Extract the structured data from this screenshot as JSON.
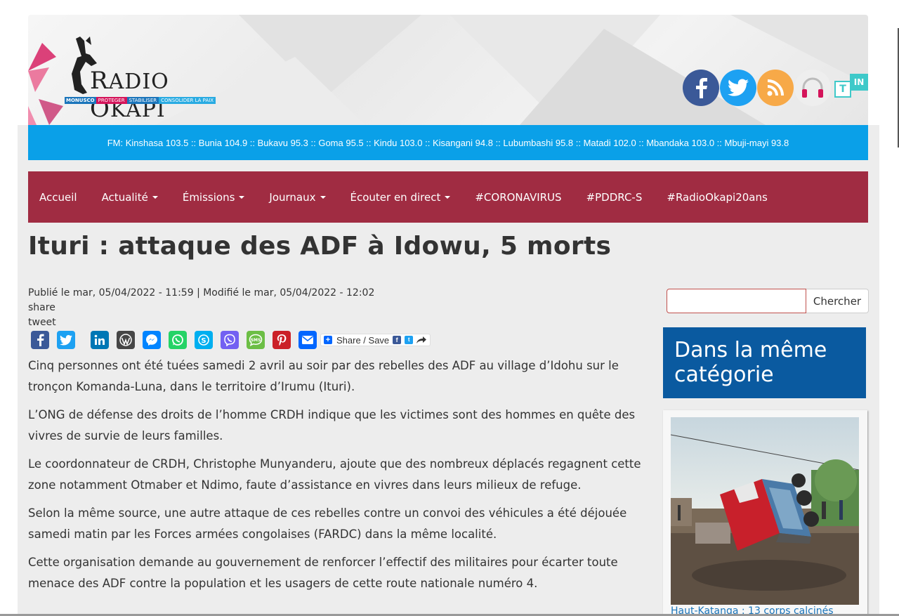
{
  "brand": {
    "name_first": "R",
    "name_rest1": "ADIO ",
    "name_second": "O",
    "name_rest2": "KAPI",
    "strip": [
      "MONUSCO",
      "PROTEGER",
      "STABILISER",
      "CONSOLIDER LA PAIX"
    ]
  },
  "social": {
    "tin_t": "T",
    "tin_in": "IN"
  },
  "fm_bar": "FM: Kinshasa 103.5 :: Bunia 104.9 :: Bukavu 95.3 :: Goma 95.5 :: Kindu 103.0 :: Kisangani 94.8 :: Lubumbashi 95.8 :: Matadi 102.0 :: Mbandaka 103.0 :: Mbuji-mayi 93.8",
  "nav": {
    "items": [
      {
        "label": "Accueil"
      },
      {
        "label": "Actualité"
      },
      {
        "label": "Émissions"
      },
      {
        "label": "Journaux"
      },
      {
        "label": "Écouter en direct"
      },
      {
        "label": "#CORONAVIRUS"
      },
      {
        "label": "#PDDRC-S"
      },
      {
        "label": "#RadioOkapi20ans"
      }
    ]
  },
  "article": {
    "title": "Ituri : attaque des ADF à Idowu, 5 morts",
    "meta": "Publié le mar, 05/04/2022 - 11:59 | Modifié le mar, 05/04/2022 - 12:02",
    "share_label": "share",
    "tweet_label": "tweet",
    "share_save": "Share / Save",
    "paragraphs": [
      " Cinq personnes ont été tuées samedi 2 avril au soir par des rebelles des ADF au village d’Idohu sur le tronçon Komanda-Luna, dans le territoire d’Irumu (Ituri).",
      "L’ONG de défense des droits de l’homme CRDH indique que les victimes sont des hommes en quête des vivres de survie de leurs familles.",
      " Le coordonnateur de CRDH, Christophe Munyanderu, ajoute que des nombreux déplacés regagnent cette zone notamment Otmaber et Ndimo, faute d’assistance en vivres dans leurs milieux de refuge.",
      "Selon la même source, une autre attaque de ces rebelles contre un convoi des véhicules a été déjouée samedi matin par les Forces armées congolaises (FARDC) dans la même localité.",
      " Cette organisation demande au gouvernement de renforcer l’effectif des militaires pour écarter toute menace des ADF contre la population et les usagers de cette route nationale numéro 4."
    ]
  },
  "sidebar": {
    "search_button": "Chercher",
    "search_value": "",
    "category_title": "Dans la même catégorie",
    "related_caption": "Haut-Katanga : 13 corps calcinés"
  },
  "colors": {
    "fm_bar": "#0aa0e8",
    "nav": "#a02c42",
    "category_box": "#0a5aa0",
    "facebook": "#3b5998",
    "twitter": "#1da1f2",
    "rss": "#f7a948"
  }
}
